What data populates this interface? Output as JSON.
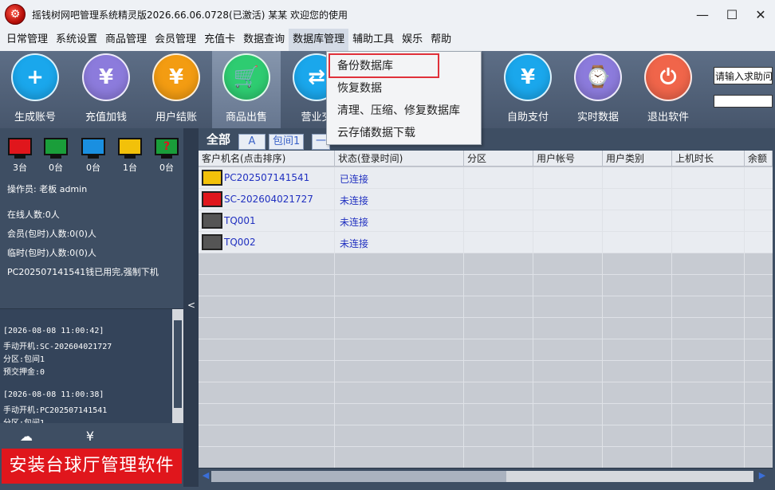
{
  "window": {
    "title": "摇钱树网吧管理系统精灵版2026.66.06.0728(已激活)   某某 欢迎您的使用",
    "minimize": "—",
    "maximize": "☐",
    "close": "✕"
  },
  "menu": {
    "items": [
      "日常管理",
      "系统设置",
      "商品管理",
      "会员管理",
      "充值卡",
      "数据查询",
      "数据库管理",
      "辅助工具",
      "娱乐",
      "帮助"
    ],
    "active": "数据库管理"
  },
  "dropdown": {
    "items": [
      "备份数据库",
      "恢复数据",
      "清理、压缩、修复数据库",
      "云存储数据下载"
    ],
    "highlighted": "备份数据库"
  },
  "toolbar": {
    "buttons": [
      {
        "label": "生成账号",
        "icon": "user-add-icon",
        "color": "#1aa7ec",
        "glyph": "+"
      },
      {
        "label": "充值加钱",
        "icon": "yen-coin-icon",
        "color": "#8c7bdc",
        "glyph": "¥"
      },
      {
        "label": "用户结账",
        "icon": "checkout-monitor-icon",
        "color": "#f39c12",
        "glyph": "¥"
      },
      {
        "label": "商品出售",
        "icon": "shopping-cart-icon",
        "color": "#2ecc71",
        "glyph": "🛒"
      },
      {
        "label": "营业交",
        "icon": "shift-handover-icon",
        "color": "#1aa7ec",
        "glyph": "⇄"
      },
      {
        "label": "自助支付",
        "icon": "mobile-pay-icon",
        "color": "#1aa7ec",
        "glyph": "¥"
      },
      {
        "label": "实时数据",
        "icon": "realtime-data-icon",
        "color": "#8c7bdc",
        "glyph": "⌚"
      },
      {
        "label": "退出软件",
        "icon": "power-icon",
        "color": "#f0654a",
        "glyph": "⏻"
      }
    ],
    "active": "商品出售",
    "search_text": "请输入求助问"
  },
  "left_panel": {
    "monitors": [
      {
        "color": "#e0161c",
        "count": "3台",
        "glyph": ""
      },
      {
        "color": "#1a9e3a",
        "count": "0台",
        "glyph": ""
      },
      {
        "color": "#1a8fe0",
        "count": "0台",
        "glyph": ""
      },
      {
        "color": "#f2c10a",
        "count": "1台",
        "glyph": ""
      },
      {
        "color": "#1a9e3a",
        "count": "0台",
        "glyph": "?"
      }
    ],
    "operator": "操作员:  老板 admin",
    "online": "在线人数:0人",
    "members": "会员(包时)人数:0(0)人",
    "temp": "临时(包时)人数:0(0)人",
    "notice": "PC202507141541钱已用完,强制下机",
    "log": [
      "[2026-08-08 11:00:42]",
      "  手动开机:SC-202604021727",
      "       分区:包间1",
      "  预交押金:0",
      "",
      "[2026-08-08 11:00:38]",
      "  手动开机:PC202507141541",
      "       分区:包间1"
    ],
    "banner": "安装台球厅管理软件"
  },
  "tabs": [
    "全部",
    "A",
    "包间1",
    "一"
  ],
  "table": {
    "columns": [
      "客户机名(点击排序)",
      "状态(登录时间)",
      "分区",
      "用户帐号",
      "用户类别",
      "上机时长",
      "余额"
    ],
    "rows": [
      {
        "name": "PC202507141541",
        "status": "已连接",
        "color": "#f2c10a"
      },
      {
        "name": "SC-202604021727",
        "status": "未连接",
        "color": "#e0161c"
      },
      {
        "name": "TQ001",
        "status": "未连接",
        "color": "#555555"
      },
      {
        "name": "TQ002",
        "status": "未连接",
        "color": "#555555"
      }
    ]
  }
}
